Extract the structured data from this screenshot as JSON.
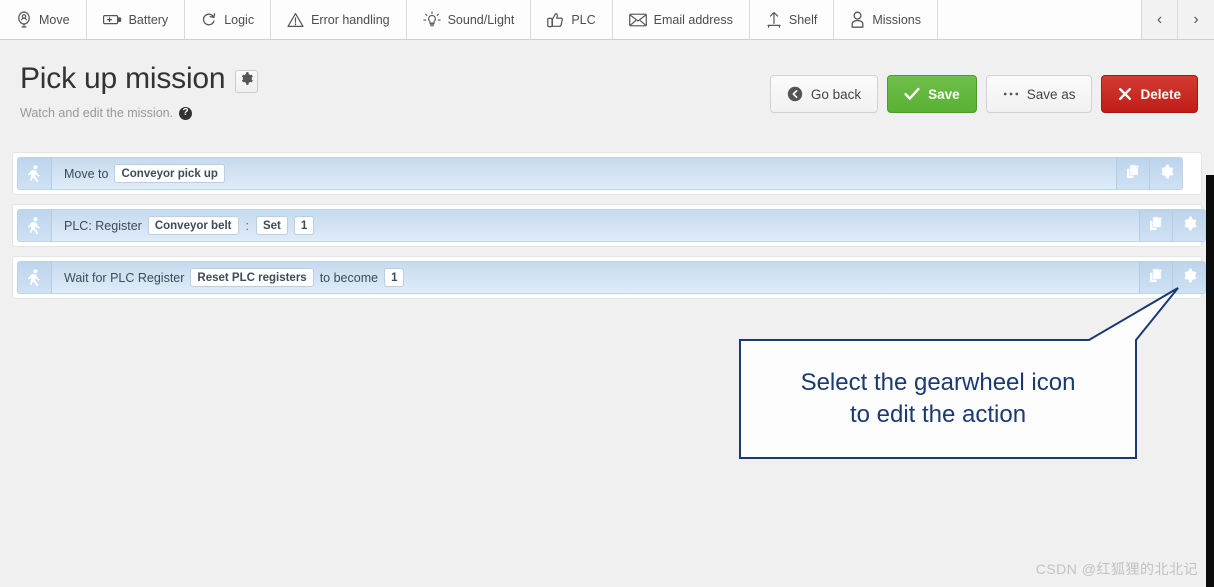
{
  "toolbar": {
    "items": [
      {
        "label": "Move",
        "icon": "location-pin-person-icon"
      },
      {
        "label": "Battery",
        "icon": "battery-icon"
      },
      {
        "label": "Logic",
        "icon": "loop-arrow-icon"
      },
      {
        "label": "Error handling",
        "icon": "warning-triangle-icon"
      },
      {
        "label": "Sound/Light",
        "icon": "lightbulb-icon"
      },
      {
        "label": "PLC",
        "icon": "thumbs-up-icon"
      },
      {
        "label": "Email address",
        "icon": "envelope-icon"
      },
      {
        "label": "Shelf",
        "icon": "upload-shelf-icon"
      },
      {
        "label": "Missions",
        "icon": "person-icon"
      }
    ],
    "prev_arrow": "‹",
    "next_arrow": "›"
  },
  "header": {
    "title": "Pick up mission",
    "title_gear_icon": "gear-icon",
    "subtitle": "Watch and edit the mission.",
    "help_icon": "question-mark-icon",
    "buttons": [
      {
        "label": "Go back",
        "icon": "back-arrow-icon",
        "style": "light"
      },
      {
        "label": "Save",
        "icon": "checkmark-icon",
        "style": "green"
      },
      {
        "label": "Save as",
        "icon": "ellipsis-icon",
        "style": "light"
      },
      {
        "label": "Delete",
        "icon": "cross-icon",
        "style": "red"
      }
    ]
  },
  "actions": {
    "row_icon": "walking-person-icon",
    "copy_icon": "duplicate-icon",
    "gear_icon": "gear-icon",
    "rows": [
      {
        "prefix": "Move to",
        "pill1": "Conveyor pick up",
        "separator": "",
        "pill2": "",
        "middle": "",
        "pill3": ""
      },
      {
        "prefix": "PLC: Register",
        "pill1": "Conveyor belt",
        "separator": ":",
        "pill2": "Set",
        "middle": "",
        "pill3": "1"
      },
      {
        "prefix": "Wait for PLC Register",
        "pill1": "Reset PLC registers",
        "separator": "",
        "pill2": "",
        "middle": "to become",
        "pill3": "1"
      }
    ]
  },
  "callout": {
    "line1": "Select the gearwheel icon",
    "line2": "to edit the action",
    "border_color": "#1a3a72"
  },
  "watermark": "CSDN @红狐狸的北北记",
  "colors": {
    "accent_green": "#59b033",
    "accent_red": "#c01d18",
    "row_blue": "#c6daee",
    "page_bg": "#f0f0f0"
  }
}
